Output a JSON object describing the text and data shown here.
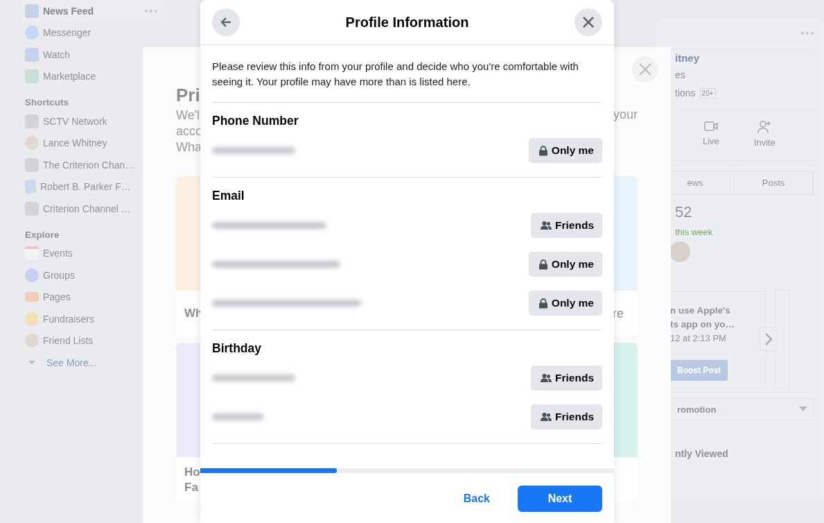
{
  "sidebar": {
    "items": [
      {
        "label": "News Feed",
        "selected": true
      },
      {
        "label": "Messenger",
        "selected": false
      },
      {
        "label": "Watch",
        "selected": false
      },
      {
        "label": "Marketplace",
        "selected": false
      }
    ],
    "sections": [
      {
        "title": "Shortcuts",
        "items": [
          {
            "label": "SCTV Network"
          },
          {
            "label": "Lance Whitney"
          },
          {
            "label": "The Criterion Chan…"
          },
          {
            "label": "Robert B. Parker F…"
          },
          {
            "label": "Criterion Channel …"
          }
        ]
      },
      {
        "title": "Explore",
        "items": [
          {
            "label": "Events"
          },
          {
            "label": "Groups"
          },
          {
            "label": "Pages"
          },
          {
            "label": "Fundraisers"
          },
          {
            "label": "Friend Lists"
          }
        ]
      }
    ],
    "see_more": "See More..."
  },
  "right_panel": {
    "name": "itney",
    "category": "es",
    "info": "tions",
    "badge": "20+",
    "actions": [
      "Live",
      "Invite"
    ],
    "tabs": [
      "ews",
      "Posts"
    ],
    "count": "52",
    "trend": "this week",
    "post": {
      "title": [
        "n use Apple's",
        "ts app on yo…"
      ],
      "time": "12 at 2:13 PM",
      "button": "Boost Post"
    },
    "promotion": "romotion",
    "recent": "ntly Viewed"
  },
  "back_dialog": {
    "title": "Pri",
    "lines": [
      "We'l",
      "acco",
      "Wha"
    ],
    "line_end": "your",
    "cards": [
      {
        "left": [
          "Wh"
        ],
        "right": [
          "re"
        ]
      },
      {
        "left": [
          "Ho",
          "Fa"
        ]
      }
    ]
  },
  "dialog": {
    "title": "Profile Information",
    "intro": "Please review this info from your profile and decide who you're comfortable with seeing it. Your profile may have more than is listed here.",
    "sections": [
      {
        "heading": "Phone Number",
        "rows": [
          {
            "kind": "lock",
            "label": "Only me"
          }
        ]
      },
      {
        "heading": "Email",
        "rows": [
          {
            "kind": "people",
            "label": "Friends"
          },
          {
            "kind": "lock",
            "label": "Only me"
          },
          {
            "kind": "lock",
            "label": "Only me"
          }
        ]
      },
      {
        "heading": "Birthday",
        "rows": [
          {
            "kind": "people",
            "label": "Friends"
          },
          {
            "kind": "people",
            "label": "Friends"
          }
        ]
      }
    ],
    "progress": {
      "level": 0.33
    },
    "back": "Back",
    "next": "Next"
  }
}
